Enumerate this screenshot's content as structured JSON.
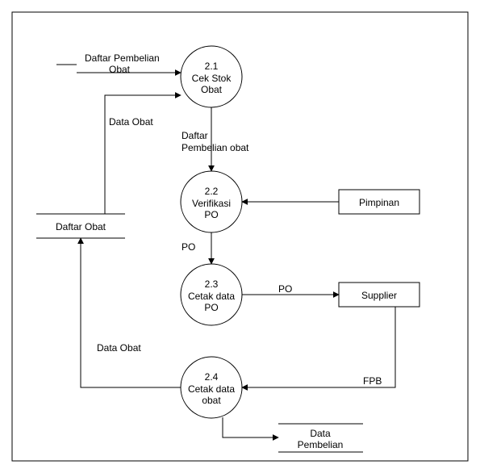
{
  "processes": {
    "p1": {
      "number": "2.1",
      "name": "Cek Stok",
      "name2": "Obat"
    },
    "p2": {
      "number": "2.2",
      "name": "Verifikasi",
      "name2": "PO"
    },
    "p3": {
      "number": "2.3",
      "name": "Cetak data",
      "name2": "PO"
    },
    "p4": {
      "number": "2.4",
      "name": "Cetak data",
      "name2": "obat"
    }
  },
  "entities": {
    "pimpinan": "Pimpinan",
    "supplier": "Supplier"
  },
  "datastores": {
    "daftar_obat": "Daftar Obat",
    "data_pembelian_top": "Data",
    "data_pembelian_bottom": "Pembelian"
  },
  "flows": {
    "daftar_pembelian_obat_in_top": "Daftar Pembelian",
    "daftar_pembelian_obat_in_bottom": "Obat",
    "data_obat_up": "Data Obat",
    "daftar_pembelian_obat_mid_top": "Daftar",
    "daftar_pembelian_obat_mid_bottom": "Pembelian obat",
    "po1": "PO",
    "po2": "PO",
    "fpb": "FPB",
    "data_obat_left": "Data Obat"
  }
}
